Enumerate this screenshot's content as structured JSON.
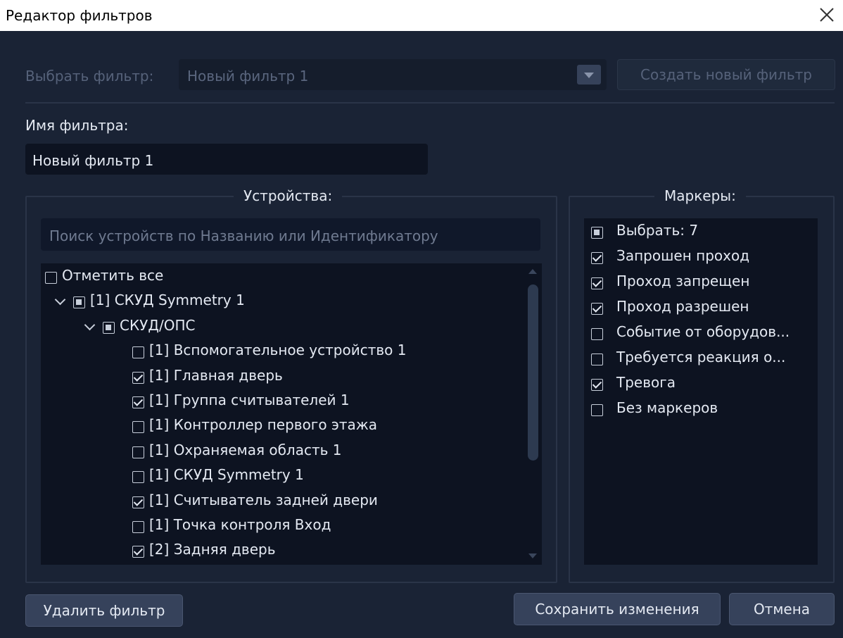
{
  "window": {
    "title": "Редактор фильтров"
  },
  "select_filter": {
    "label": "Выбрать фильтр:",
    "value": "Новый фильтр 1",
    "create_button": "Создать новый фильтр"
  },
  "filter_name": {
    "label": "Имя фильтра:",
    "value": "Новый фильтр 1"
  },
  "devices": {
    "title": "Устройства:",
    "search_placeholder": "Поиск устройств по Названию или Идентификатору",
    "tree": [
      {
        "label": "Отметить все",
        "state": "unchecked"
      },
      {
        "label": "[1] СКУД Symmetry 1",
        "state": "partial",
        "expanded": true
      },
      {
        "label": "СКУД/ОПС",
        "state": "partial",
        "expanded": true
      },
      {
        "label": "[1] Вспомогательное устройство 1",
        "state": "unchecked"
      },
      {
        "label": "[1] Главная дверь",
        "state": "checked"
      },
      {
        "label": "[1] Группа считывателей 1",
        "state": "checked"
      },
      {
        "label": "[1] Контроллер первого этажа",
        "state": "unchecked"
      },
      {
        "label": "[1] Охраняемая область 1",
        "state": "unchecked"
      },
      {
        "label": "[1] СКУД Symmetry 1",
        "state": "unchecked"
      },
      {
        "label": "[1] Считыватель задней двери",
        "state": "checked"
      },
      {
        "label": "[1] Точка контроля Вход",
        "state": "unchecked"
      },
      {
        "label": "[2] Задняя дверь",
        "state": "checked"
      }
    ]
  },
  "markers": {
    "title": "Маркеры:",
    "items": [
      {
        "label": "Выбрать: 7",
        "state": "partial"
      },
      {
        "label": "Запрошен проход",
        "state": "checked"
      },
      {
        "label": "Проход запрещен",
        "state": "checked"
      },
      {
        "label": "Проход разрешен",
        "state": "checked"
      },
      {
        "label": "Событие от оборудов...",
        "state": "unchecked"
      },
      {
        "label": "Требуется реакция о...",
        "state": "unchecked"
      },
      {
        "label": "Тревога",
        "state": "checked"
      },
      {
        "label": "Без маркеров",
        "state": "unchecked"
      }
    ]
  },
  "buttons": {
    "delete": "Удалить фильтр",
    "save": "Сохранить изменения",
    "cancel": "Отмена"
  },
  "colors": {
    "background": "#1a2335",
    "panel": "#0d1321",
    "button": "#36425b",
    "muted_text": "#56627a"
  }
}
